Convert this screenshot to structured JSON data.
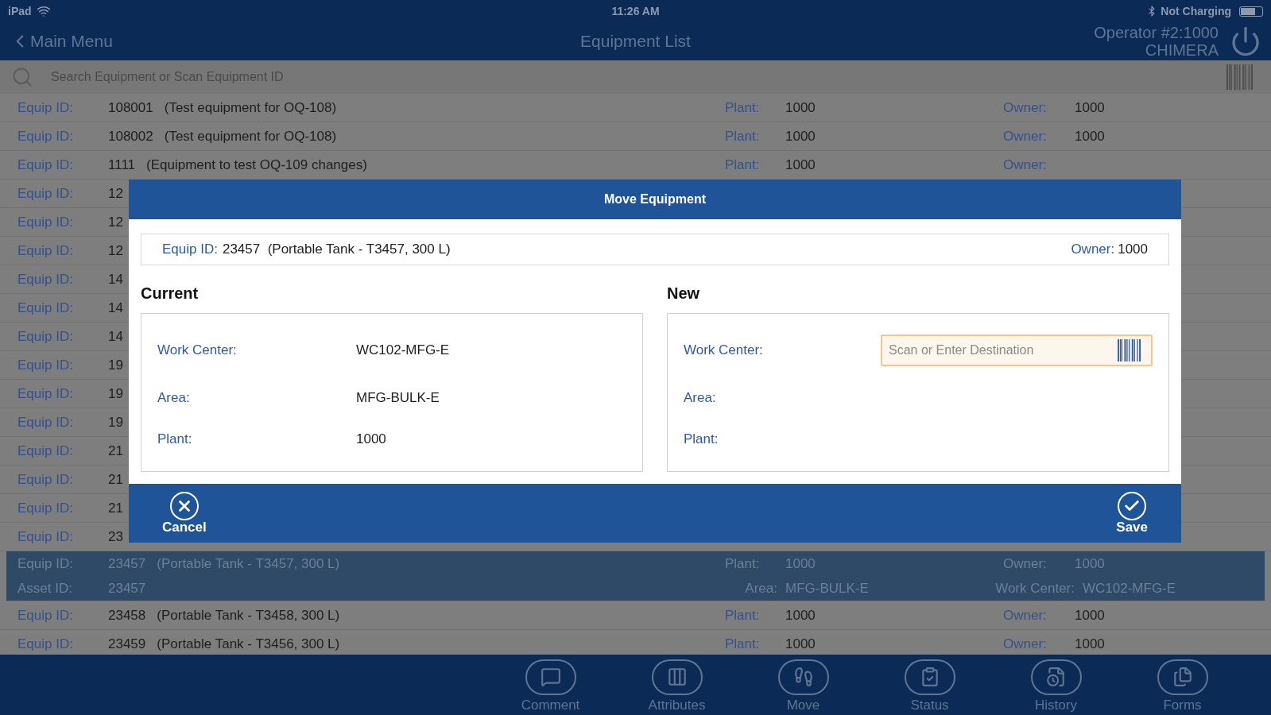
{
  "status_bar": {
    "device": "iPad",
    "time": "11:26 AM",
    "battery": "Not Charging"
  },
  "nav": {
    "back": "Main Menu",
    "title": "Equipment List",
    "operator": "Operator #2:1000",
    "operator_name": "CHIMERA"
  },
  "search": {
    "placeholder": "Search Equipment or Scan Equipment ID"
  },
  "rows": [
    {
      "id_label": "Equip ID:",
      "id": "108001",
      "description": "(Test equipment for OQ-108)",
      "plant_label": "Plant:",
      "plant": "1000",
      "owner_label": "Owner:",
      "owner": "1000",
      "selected": false
    },
    {
      "id_label": "Equip ID:",
      "id": "108002",
      "description": "(Test equipment for OQ-108)",
      "plant_label": "Plant:",
      "plant": "1000",
      "owner_label": "Owner:",
      "owner": "1000",
      "selected": false
    },
    {
      "id_label": "Equip ID:",
      "id": "1111",
      "description": "(Equipment to test OQ-109 changes)",
      "plant_label": "Plant:",
      "plant": "1000",
      "owner_label": "Owner:",
      "selected": false
    },
    {
      "id_label": "Equip ID:",
      "id": "12",
      "selected": false
    },
    {
      "id_label": "Equip ID:",
      "id": "12",
      "selected": false
    },
    {
      "id_label": "Equip ID:",
      "id": "12",
      "selected": false
    },
    {
      "id_label": "Equip ID:",
      "id": "14",
      "selected": false
    },
    {
      "id_label": "Equip ID:",
      "id": "14",
      "selected": false
    },
    {
      "id_label": "Equip ID:",
      "id": "14",
      "selected": false
    },
    {
      "id_label": "Equip ID:",
      "id": "19",
      "selected": false
    },
    {
      "id_label": "Equip ID:",
      "id": "19",
      "selected": false
    },
    {
      "id_label": "Equip ID:",
      "id": "19",
      "selected": false
    },
    {
      "id_label": "Equip ID:",
      "id": "21",
      "selected": false
    },
    {
      "id_label": "Equip ID:",
      "id": "21",
      "selected": false
    },
    {
      "id_label": "Equip ID:",
      "id": "21",
      "selected": false
    },
    {
      "id_label": "Equip ID:",
      "id": "23",
      "selected": false
    },
    {
      "id_label": "Equip ID:",
      "id": "23457",
      "description": "(Portable Tank - T3457, 300 L)",
      "plant_label": "Plant:",
      "plant": "1000",
      "owner_label": "Owner:",
      "owner": "1000",
      "asset_label": "Asset ID:",
      "asset": "23457",
      "area_label": "Area:",
      "area": "MFG-BULK-E",
      "work_center_label": "Work Center:",
      "work_center": "WC102-MFG-E",
      "selected": true
    },
    {
      "id_label": "Equip ID:",
      "id": "23458",
      "description": "(Portable Tank - T3458, 300 L)",
      "plant_label": "Plant:",
      "plant": "1000",
      "owner_label": "Owner:",
      "owner": "1000",
      "selected": false
    },
    {
      "id_label": "Equip ID:",
      "id": "23459",
      "description": "(Portable Tank - T3456, 300 L)",
      "plant_label": "Plant:",
      "plant": "1000",
      "owner_label": "Owner:",
      "owner": "1000",
      "selected": false
    }
  ],
  "dialog": {
    "title": "Move Equipment",
    "equip_label": "Equip ID:",
    "equip": "23457  (Portable Tank - T3457, 300 L)",
    "owner_label": "Owner:",
    "owner": "1000",
    "current": {
      "heading": "Current",
      "fields": [
        {
          "label": "Work Center:",
          "value": "WC102-MFG-E"
        },
        {
          "label": "Area:",
          "value": "MFG-BULK-E"
        },
        {
          "label": "Plant:",
          "value": "1000"
        }
      ]
    },
    "new": {
      "heading": "New",
      "fields": [
        {
          "label": "Work Center:",
          "kind": "input",
          "placeholder": "Scan or Enter Destination"
        },
        {
          "label": "Area:",
          "kind": "text"
        },
        {
          "label": "Plant:",
          "kind": "text"
        }
      ]
    },
    "cancel": "Cancel",
    "save": "Save"
  },
  "tab_bar": [
    {
      "label": "Comment"
    },
    {
      "label": "Attributes"
    },
    {
      "label": "Move"
    },
    {
      "label": "Status"
    },
    {
      "label": "History"
    },
    {
      "label": "Forms"
    }
  ]
}
